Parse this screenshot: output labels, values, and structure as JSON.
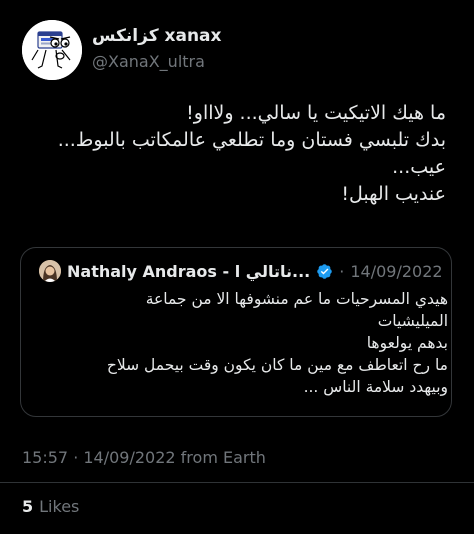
{
  "author": {
    "display_name": "كزانكس xanax",
    "handle": "@XanaX_ultra",
    "avatar_icon": "xanax-face-avatar"
  },
  "tweet": {
    "lines": [
      "ما هيك الاتيكيت يا سالي... ولاااو!",
      "بدك تلبسي فستان وما تطلعي عالمكاتب بالبوط...",
      "عيب...",
      "عنديب الهبل!"
    ]
  },
  "quoted_tweet": {
    "author_name": "Nathaly Andraos - ناتالي ا...",
    "verified_icon": "verified-badge-icon",
    "date_sep": "·",
    "date": "14/09/2022",
    "lines": [
      "هيدي المسرحيات ما عم منشوفها الا من جماعة",
      "الميليشيات",
      "بدهم يولعوها",
      "ما رح اتعاطف مع مين ما كان يكون وقت بيحمل سلاح",
      "وبيهدد سلامة الناس ..."
    ]
  },
  "meta": {
    "timestamp": "15:57 · 14/09/2022 from Earth"
  },
  "stats": {
    "likes_count": "5",
    "likes_label": "Likes"
  },
  "colors": {
    "background": "#000000",
    "text": "#e7e9ea",
    "secondary": "#71767b",
    "verified": "#1d9bf0",
    "border": "#333639"
  }
}
